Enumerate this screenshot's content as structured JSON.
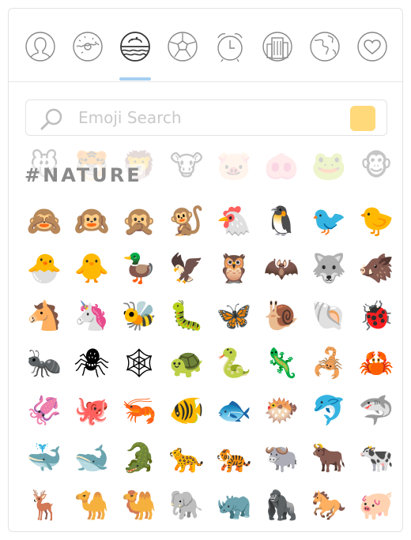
{
  "categories": [
    {
      "name": "people",
      "icon": "person-icon"
    },
    {
      "name": "food",
      "icon": "donut-icon"
    },
    {
      "name": "nature",
      "icon": "nature-icon",
      "active": true
    },
    {
      "name": "activity",
      "icon": "soccer-ball-icon"
    },
    {
      "name": "travel",
      "icon": "alarm-clock-icon"
    },
    {
      "name": "places",
      "icon": "building-icon"
    },
    {
      "name": "objects",
      "icon": "globe-icon"
    },
    {
      "name": "symbols",
      "icon": "heart-icon"
    }
  ],
  "search": {
    "placeholder": "Emoji Search",
    "value": ""
  },
  "skin_tone_color": "#ffd97a",
  "accent_color": "#a6cff2",
  "section_title": "#NATURE",
  "ghost_row": [
    "🐭",
    "🐯",
    "🦁",
    "🐮",
    "🐷",
    "🐽",
    "🐸",
    "🐵"
  ],
  "emojis": [
    "🙈",
    "🙉",
    "🙊",
    "🐒",
    "🐔",
    "🐧",
    "🐦",
    "🐤",
    "🐣",
    "🐥",
    "🦆",
    "🦅",
    "🦉",
    "🦇",
    "🐺",
    "🐗",
    "🐴",
    "🦄",
    "🐝",
    "🐛",
    "🦋",
    "🐌",
    "🐚",
    "🐞",
    "🐜",
    "🕷",
    "🕸",
    "🐢",
    "🐍",
    "🦎",
    "🦂",
    "🦀",
    "🦑",
    "🐙",
    "🦐",
    "🐠",
    "🐟",
    "🐡",
    "🐬",
    "🦈",
    "🐳",
    "🐋",
    "🐊",
    "🐆",
    "🐅",
    "🐃",
    "🐂",
    "🐄",
    "🦌",
    "🐪",
    "🐫",
    "🐘",
    "🦏",
    "🦍",
    "🐎",
    "🐖"
  ]
}
